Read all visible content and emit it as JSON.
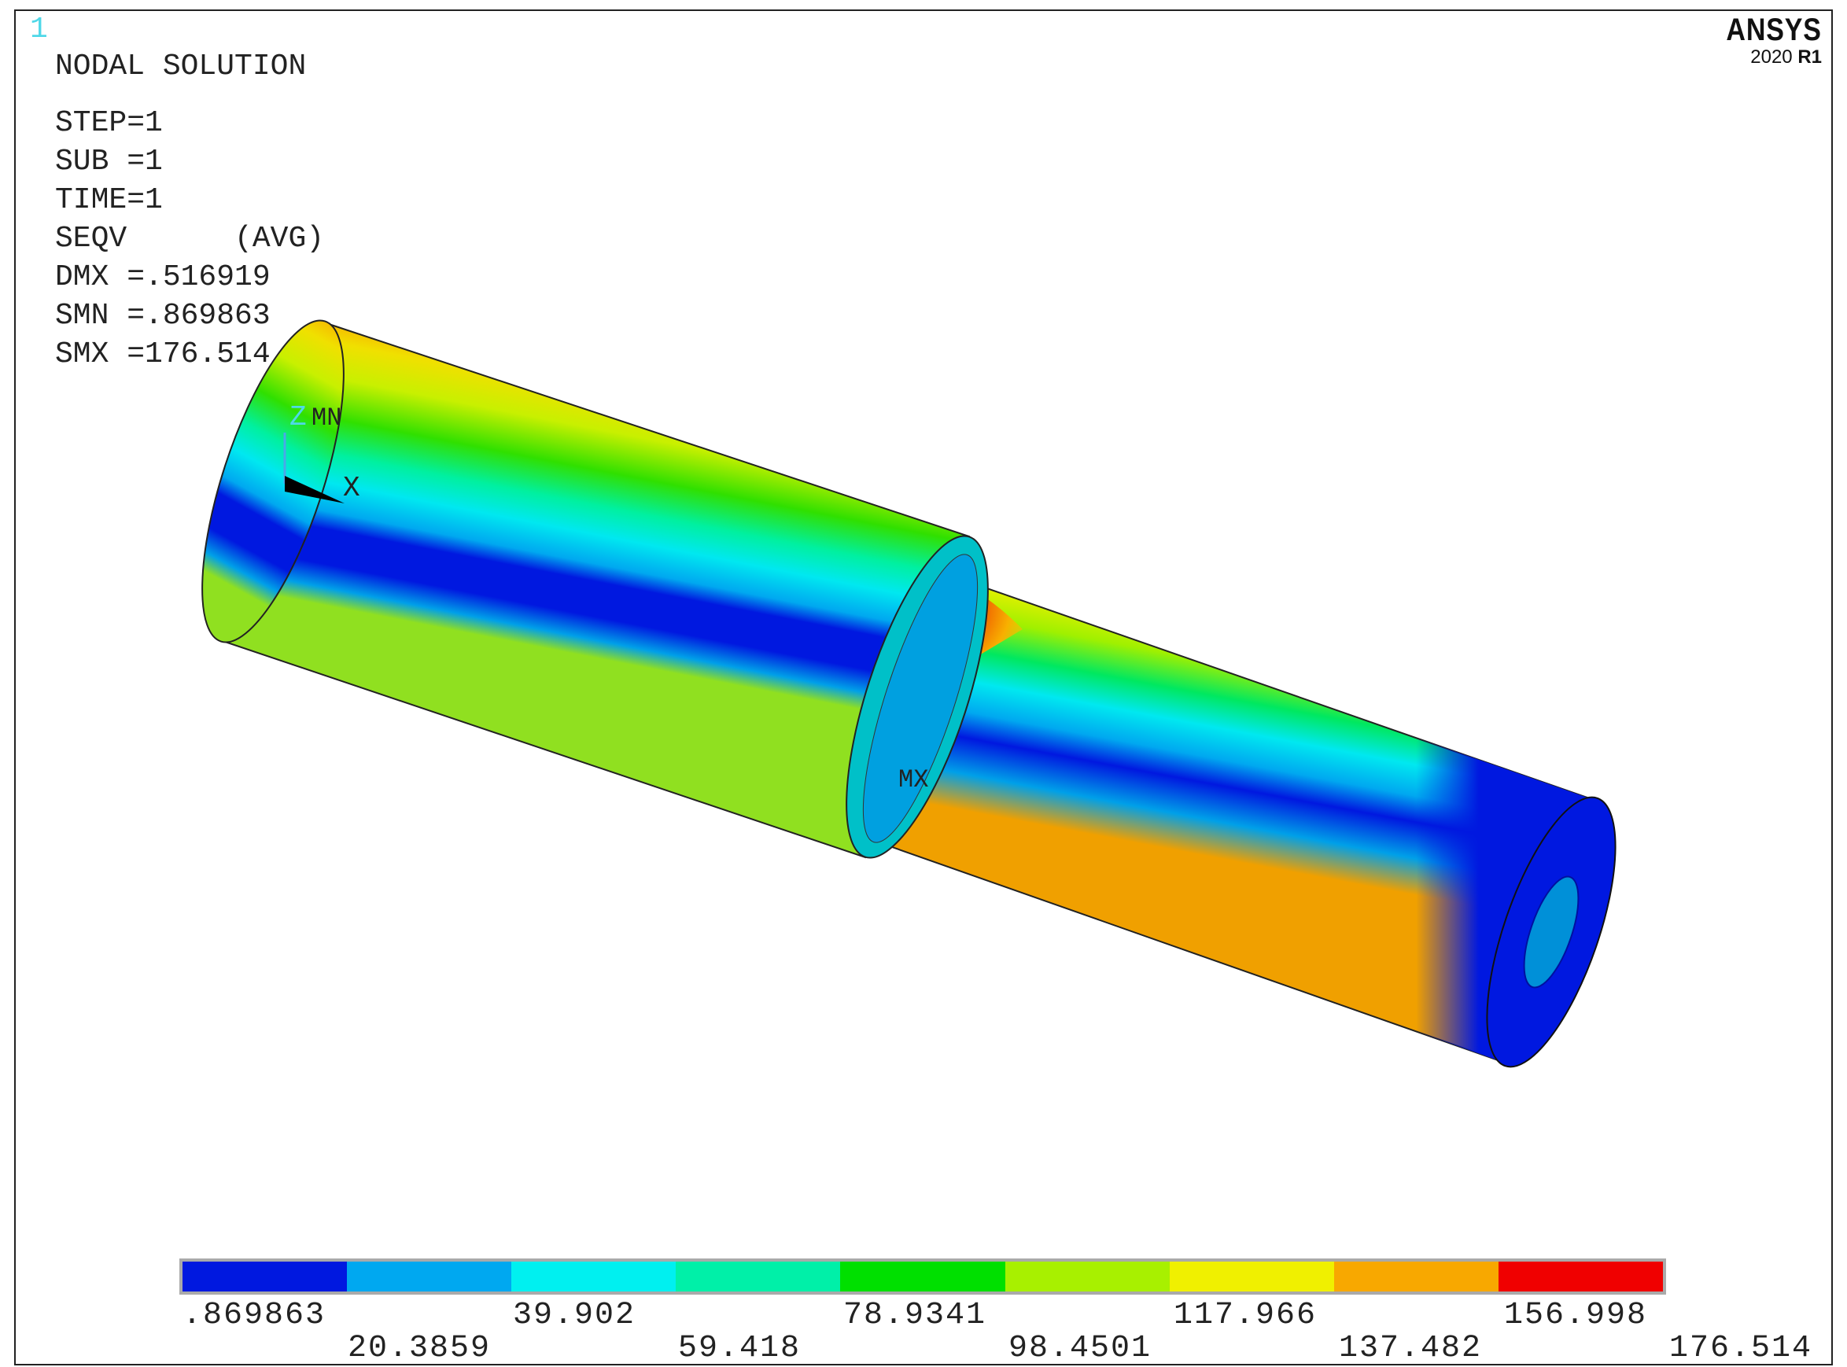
{
  "window_number": "1",
  "brand": {
    "name": "ANSYS",
    "version_prefix": "2020 ",
    "version_suffix": "R1"
  },
  "header": {
    "title": "NODAL SOLUTION",
    "lines": [
      "STEP=1",
      "SUB =1",
      "TIME=1",
      "SEQV      (AVG)",
      "DMX =.516919",
      "SMN =.869863",
      "SMX =176.514"
    ]
  },
  "markers": {
    "min": "MN",
    "max": "MX"
  },
  "triad": {
    "z_label": "Z",
    "x_label": "X"
  },
  "legend": {
    "colors": [
      "#0018e0",
      "#00a8f0",
      "#00f0f0",
      "#00f0a8",
      "#00e000",
      "#a8f000",
      "#f0f000",
      "#f8a800",
      "#f00000"
    ],
    "top_labels": [
      ".869863",
      "39.902",
      "78.9341",
      "117.966",
      "156.998"
    ],
    "bottom_labels": [
      "20.3859",
      "59.418",
      "98.4501",
      "137.482",
      "176.514"
    ]
  }
}
